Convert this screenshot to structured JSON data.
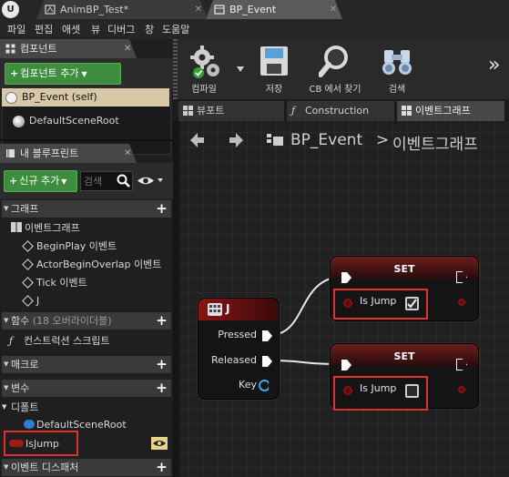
{
  "window": {
    "tabs": [
      {
        "label": "AnimBP_Test*"
      },
      {
        "label": "BP_Event"
      }
    ]
  },
  "menu": [
    "파일",
    "편집",
    "애셋",
    "뷰",
    "디버그",
    "창",
    "도움말"
  ],
  "components_panel": {
    "title": "컴포넌트",
    "add_button": "컴포넌트 추가",
    "items": [
      "BP_Event (self)",
      "DefaultSceneRoot"
    ]
  },
  "my_blueprint": {
    "title": "내 블루프린트",
    "add_new": "신규 추가",
    "search_placeholder": "검색",
    "sections": {
      "graphs": "그래프",
      "event_graph": "이벤트그래프",
      "events": [
        "BeginPlay 이벤트",
        "ActorBeginOverlap 이벤트",
        "Tick 이벤트",
        "J"
      ],
      "functions": "함수",
      "functions_count": "(18 오버라이더블)",
      "construction_script": "컨스트럭션 스크립트",
      "macros": "매크로",
      "variables": "변수",
      "components": "디폴트",
      "default_scene_root": "DefaultSceneRoot",
      "is_jump": "IsJump",
      "event_dispatchers": "이벤트 디스패처"
    }
  },
  "toolbar": {
    "compile": "컴파일",
    "save": "저장",
    "find_in_cb": "CB 에서 찾기",
    "search": "검색",
    "more": "»"
  },
  "graph_tabs": [
    "뷰포트",
    "Construction",
    "이벤트그래프"
  ],
  "breadcrumb": {
    "blueprint": "BP_Event",
    "separator": ">",
    "graph": "이벤트그래프"
  },
  "nodes": {
    "input_node": {
      "title": "J",
      "pins": [
        "Pressed",
        "Released",
        "Key"
      ]
    },
    "set_top": {
      "title": "SET",
      "var": "Is Jump",
      "checked": true
    },
    "set_bottom": {
      "title": "SET",
      "var": "Is Jump",
      "checked": false
    }
  },
  "colors": {
    "accent_green": "#3d8f3d",
    "highlight_red": "#e03030",
    "bool_pin": "#8a1010",
    "set_header": "#5a1818",
    "input_header": "#7a1414"
  }
}
